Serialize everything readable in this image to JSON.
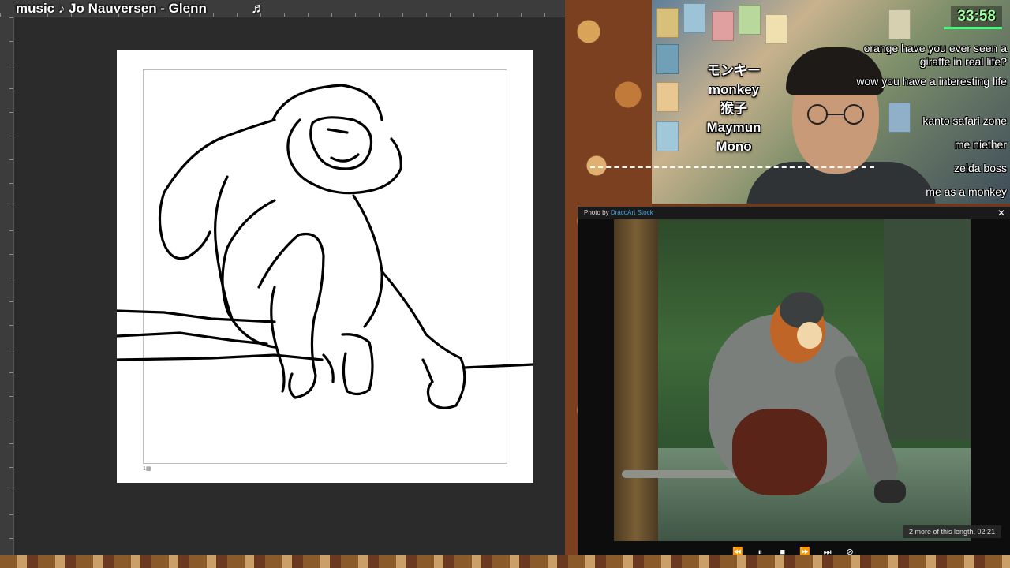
{
  "editor": {
    "music_title": "music ♪ Jo Nauversen - Glenn",
    "music_note": "♬",
    "canvas_marker": "1▦"
  },
  "webcam": {
    "timer": "33:58",
    "words": [
      "モンキー",
      "monkey",
      "猴子",
      "Maymun",
      "Mono"
    ],
    "chat": [
      "orange have you ever seen a",
      "giraffe in real life?",
      "wow you have a interesting life",
      "kanto safari zone",
      "me niether",
      "zelda boss",
      "me as a monkey"
    ]
  },
  "viewer": {
    "credit_prefix": "Photo by",
    "credit_author": "DracoArt Stock",
    "close_icon": "✕",
    "more_label": "2 more of this length, 02:21",
    "controls": [
      {
        "name": "rewind-icon",
        "glyph": "⏪"
      },
      {
        "name": "pause-icon",
        "glyph": "⏸"
      },
      {
        "name": "stop-icon",
        "glyph": "■"
      },
      {
        "name": "fast-forward-icon",
        "glyph": "⏩"
      },
      {
        "name": "skip-next-icon",
        "glyph": "⏭"
      },
      {
        "name": "hide-icon",
        "glyph": "⊘"
      }
    ]
  },
  "colors": {
    "timer": "#9fff9f",
    "credit_author": "#4aa3df",
    "canvas": "#ffffff",
    "editor_bg": "#2b2b2b"
  }
}
